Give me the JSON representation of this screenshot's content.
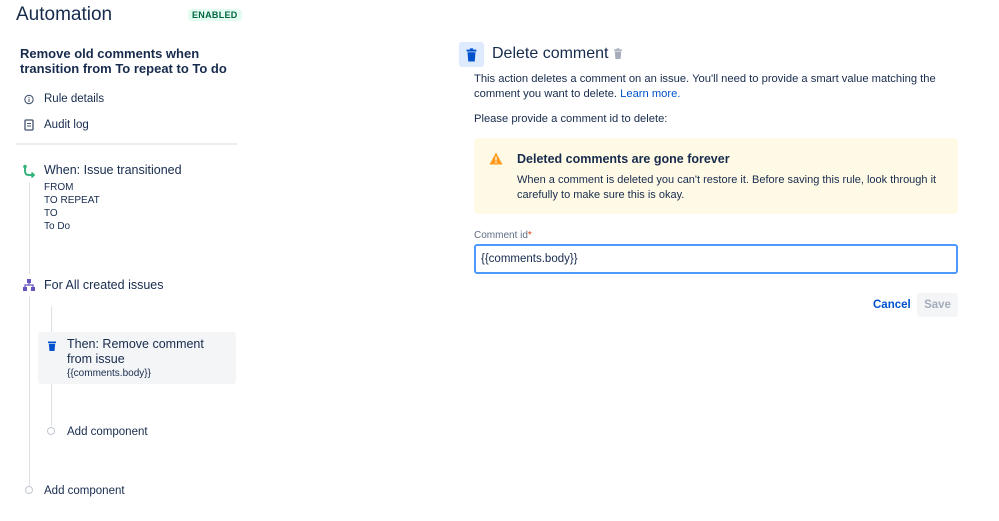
{
  "header": {
    "title": "Automation",
    "status_badge": "ENABLED"
  },
  "sidebar": {
    "rule_name": "Remove old comments when transition from To repeat to To do",
    "links": [
      {
        "label": "Rule details",
        "icon": "info-icon"
      },
      {
        "label": "Audit log",
        "icon": "document-icon"
      }
    ],
    "trigger": {
      "title": "When: Issue transitioned",
      "lines": [
        "FROM",
        "TO REPEAT",
        "TO",
        "To Do"
      ],
      "icon": "transition-icon",
      "color": "#36b37e"
    },
    "branch": {
      "title": "For All created issues",
      "icon": "branch-icon",
      "color": "#6554c0"
    },
    "action": {
      "title": "Then: Remove comment from issue",
      "subtitle": "{{comments.body}}",
      "icon": "trash-icon",
      "color": "#0052cc"
    },
    "add_component_inner": "Add component",
    "add_component_outer": "Add component"
  },
  "main": {
    "title": "Delete comment",
    "description": "This action deletes a comment on an issue. You'll need to provide a smart value matching the comment you want to delete.",
    "learn_more": "Learn more.",
    "prompt": "Please provide a comment id to delete:",
    "warning": {
      "title": "Deleted comments are gone forever",
      "body": "When a comment is deleted you can't restore it. Before saving this rule, look through it carefully to make sure this is okay.",
      "color": "#ff991f"
    },
    "field": {
      "label": "Comment id",
      "required_mark": "*",
      "value": "{{comments.body}}"
    },
    "buttons": {
      "cancel": "Cancel",
      "save": "Save"
    }
  }
}
